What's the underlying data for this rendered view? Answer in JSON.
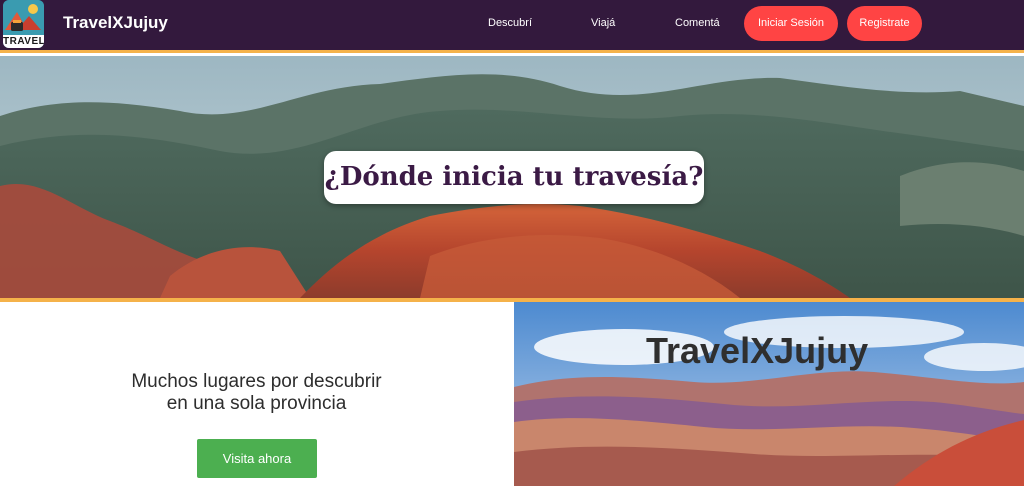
{
  "navbar": {
    "logo_text": "TRAVEL",
    "brand": "TravelXJujuy",
    "links": [
      "Descubrí",
      "Viajá",
      "Comentá"
    ],
    "login_label": "Iniciar Sesión",
    "register_label": "Registrate"
  },
  "hero": {
    "title": "¿Dónde inicia tu travesía?"
  },
  "promo": {
    "line1": "Muchos lugares por descubrir",
    "line2": "en una sola provincia",
    "cta_label": "Visita ahora"
  },
  "panel": {
    "title": "TravelXJujuy"
  },
  "colors": {
    "navbar_bg": "#33193d",
    "accent_border": "#f5b24a",
    "pill_button": "#ff4444",
    "cta_button": "#4caf50",
    "hero_title_text": "#3b1a45"
  }
}
